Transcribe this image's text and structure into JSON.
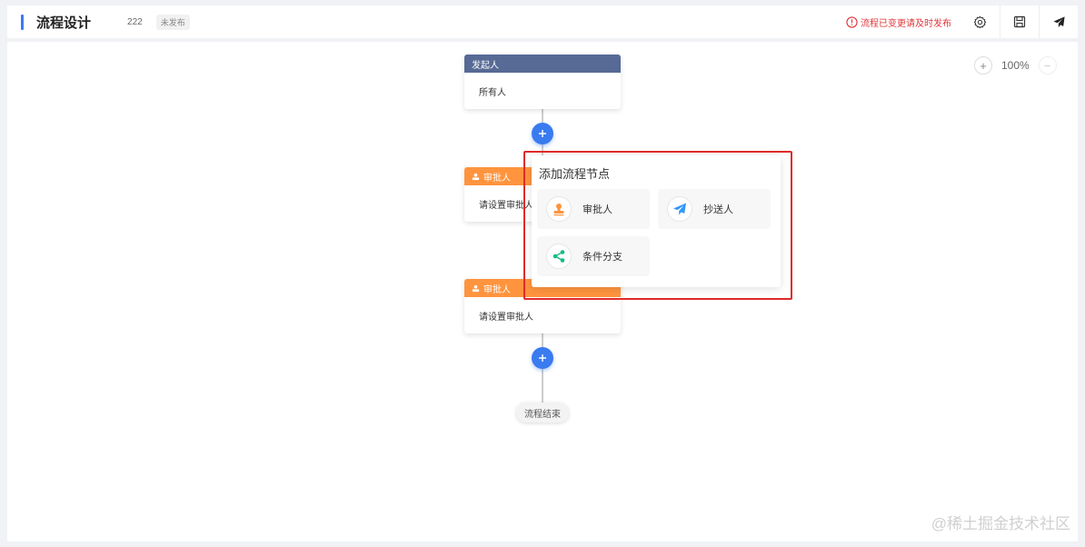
{
  "header": {
    "title": "流程设计",
    "version": "222",
    "status_badge": "未发布",
    "warning": "流程已变更请及时发布"
  },
  "zoom": {
    "in": "+",
    "value": "100%",
    "out": "−"
  },
  "flow": {
    "start_node": {
      "title": "发起人",
      "content": "所有人"
    },
    "approver_node_1": {
      "title": "审批人",
      "content": "请设置审批人"
    },
    "approver_node_2": {
      "title": "审批人",
      "content": "请设置审批人"
    },
    "end_node": "流程结束"
  },
  "popover": {
    "title": "添加流程节点",
    "options": [
      {
        "label": "审批人",
        "icon": "stamp-icon",
        "color": "#ff943e"
      },
      {
        "label": "抄送人",
        "icon": "send-icon",
        "color": "#3296fa"
      },
      {
        "label": "条件分支",
        "icon": "branch-icon",
        "color": "#15bc83"
      }
    ]
  },
  "watermark": "@稀土掘金技术社区",
  "colors": {
    "accent": "#3a7bf0",
    "start_header": "#576a95",
    "approver_header": "#ff943e",
    "warning": "#e0353a",
    "highlight": "#e02a2a"
  }
}
